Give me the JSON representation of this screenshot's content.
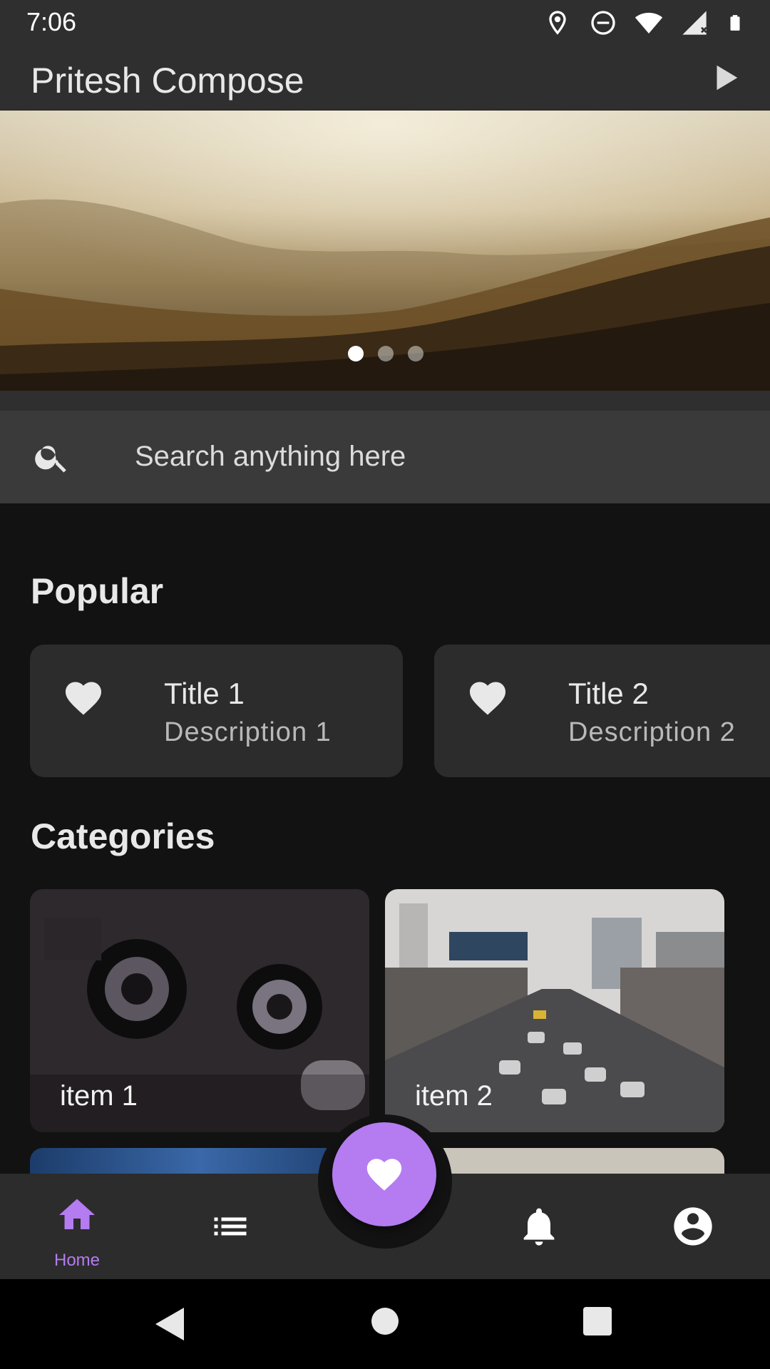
{
  "status_bar": {
    "time": "7:06",
    "icons": [
      "location-icon",
      "do-not-disturb-icon",
      "wifi-icon",
      "signal-icon",
      "battery-icon"
    ]
  },
  "app_bar": {
    "title": "Pritesh Compose",
    "action_icon": "play-icon"
  },
  "banner": {
    "page_count": 3,
    "active_page": 1
  },
  "search": {
    "placeholder": "Search anything here",
    "icon": "search-icon"
  },
  "popular": {
    "title": "Popular",
    "items": [
      {
        "title": "Title 1",
        "description": "Description 1",
        "icon": "heart-icon"
      },
      {
        "title": "Title 2",
        "description": "Description 2",
        "icon": "heart-icon"
      }
    ]
  },
  "categories": {
    "title": "Categories",
    "items": [
      {
        "label": "item 1"
      },
      {
        "label": "item 2"
      }
    ]
  },
  "bottom_nav": {
    "items": [
      {
        "label": "Home",
        "icon": "home-icon",
        "selected": true
      },
      {
        "label": "",
        "icon": "list-icon",
        "selected": false
      },
      {
        "label": "",
        "icon": "bell-icon",
        "selected": false
      },
      {
        "label": "",
        "icon": "account-icon",
        "selected": false
      }
    ],
    "fab_icon": "heart-icon"
  },
  "colors": {
    "accent": "#b47cf0",
    "background": "#121212",
    "surface": "#2c2c2c"
  }
}
